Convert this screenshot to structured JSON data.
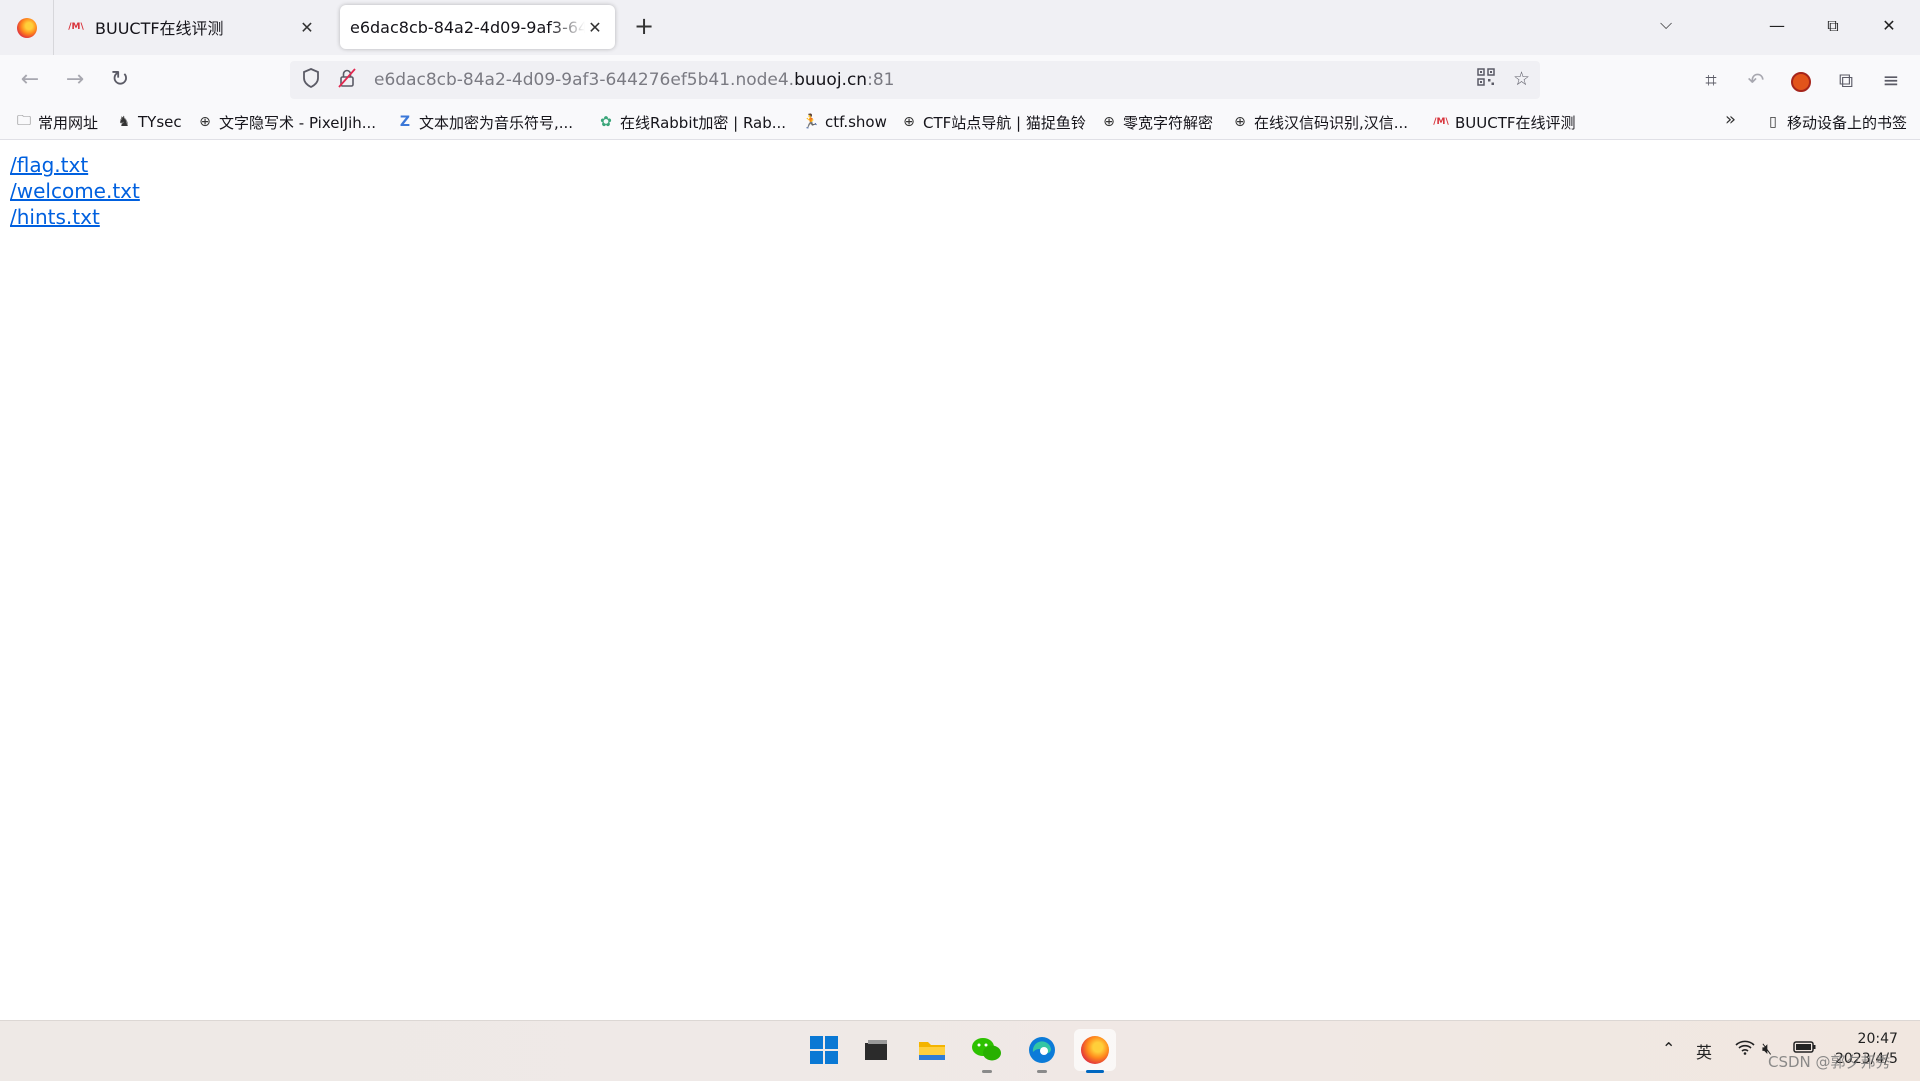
{
  "tabs": [
    {
      "title": "BUUCTF在线评测",
      "favicon": "buu-favicon",
      "active": false
    },
    {
      "title": "e6dac8cb-84a2-4d09-9af3-644276ef5b41.node4.buuoj.cn:81",
      "favicon": "",
      "active": true
    }
  ],
  "window_controls": {
    "minimize": "—",
    "maximize": "⧉",
    "close": "✕"
  },
  "urlbar": {
    "prefix": "e6dac8cb-84a2-4d09-9af3-644276ef5b41.node4.",
    "domain": "buuoj.cn",
    "suffix": ":81"
  },
  "bookmarks": [
    {
      "label": "常用网址",
      "icon": "folder-icon"
    },
    {
      "label": "TYsec",
      "icon": "tysec-icon"
    },
    {
      "label": "文字隐写术 - PixelJih...",
      "icon": "globe-icon"
    },
    {
      "label": "文本加密为音乐符号,...",
      "icon": "zj-icon"
    },
    {
      "label": "在线Rabbit加密 | Rab...",
      "icon": "gear-icon"
    },
    {
      "label": "ctf.show",
      "icon": "runner-icon"
    },
    {
      "label": "CTF站点导航 | 猫捉鱼铃",
      "icon": "globe-icon"
    },
    {
      "label": "零宽字符解密",
      "icon": "globe-icon"
    },
    {
      "label": "在线汉信码识别,汉信...",
      "icon": "globe-icon"
    },
    {
      "label": "BUUCTF在线评测",
      "icon": "buu-favicon"
    }
  ],
  "mobile_bookmarks": "移动设备上的书签",
  "page_links": [
    "/flag.txt",
    "/welcome.txt",
    "/hints.txt"
  ],
  "taskbar": {
    "ime": "英",
    "time": "20:47",
    "date": "2023/4/5"
  },
  "watermark": "CSDN @郭夕邦秀"
}
